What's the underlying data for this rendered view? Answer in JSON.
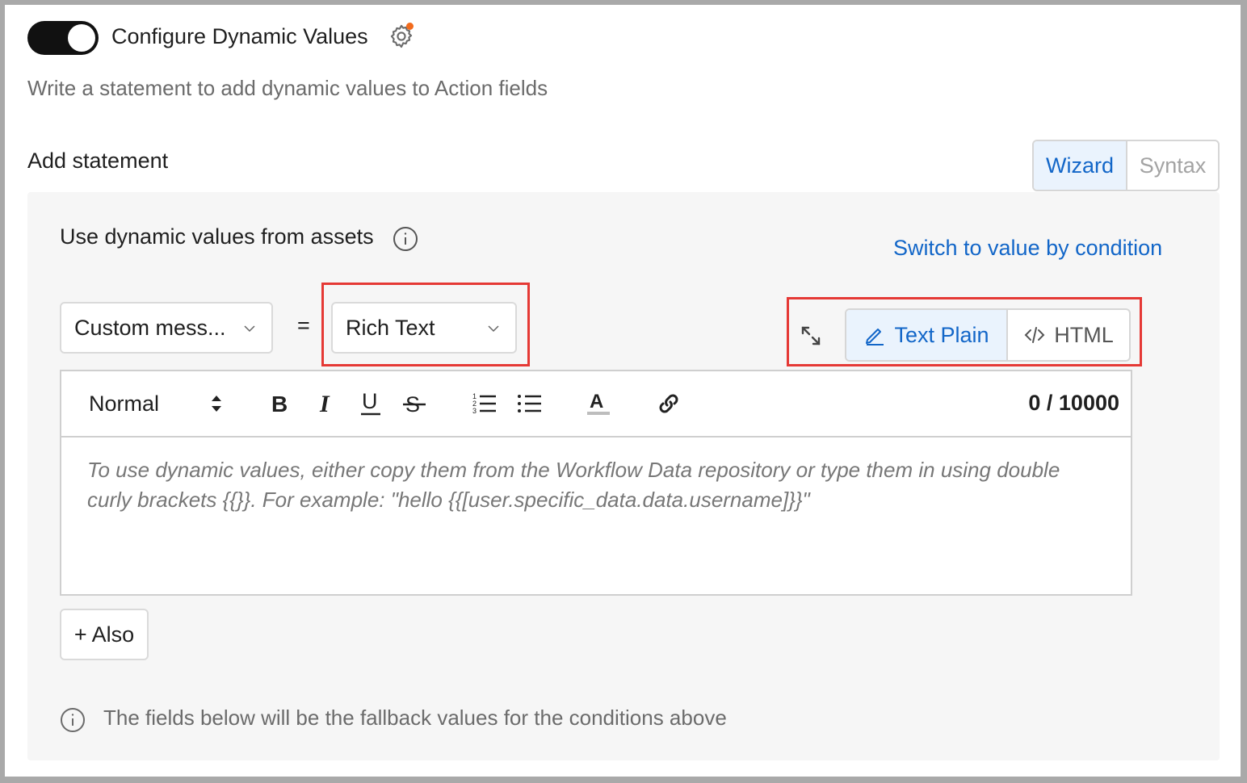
{
  "header": {
    "toggle_state": "on",
    "title": "Configure Dynamic Values",
    "settings_icon": "gear-icon",
    "notification_color": "#f26b1d",
    "subtitle": "Write a statement to add dynamic values to Action fields"
  },
  "statement": {
    "label": "Add statement",
    "modes": [
      "Wizard",
      "Syntax"
    ],
    "active_mode": "Wizard"
  },
  "panel": {
    "heading": "Use dynamic values from assets",
    "switch_link": "Switch to value by condition",
    "field_select": "Custom mess...",
    "equals": "=",
    "type_select": "Rich Text",
    "format_options": [
      "Text Plain",
      "HTML"
    ],
    "active_format": "Text Plain",
    "editor": {
      "style_select": "Normal",
      "counter": "0 / 10000",
      "toolbar_icons": [
        "bold-icon",
        "italic-icon",
        "underline-icon",
        "strikethrough-icon",
        "ordered-list-icon",
        "bullet-list-icon",
        "text-color-icon",
        "link-icon"
      ],
      "placeholder": "To use dynamic values, either copy them from the Workflow Data repository or type them in using double curly brackets {{}}. For example: \"hello {{[user.specific_data.data.username]}}\""
    },
    "also_button": "+ Also",
    "fallback_note": "The fields below will be the fallback values for the conditions above"
  },
  "colors": {
    "accent": "#1266c8",
    "highlight_border": "#e53935"
  }
}
